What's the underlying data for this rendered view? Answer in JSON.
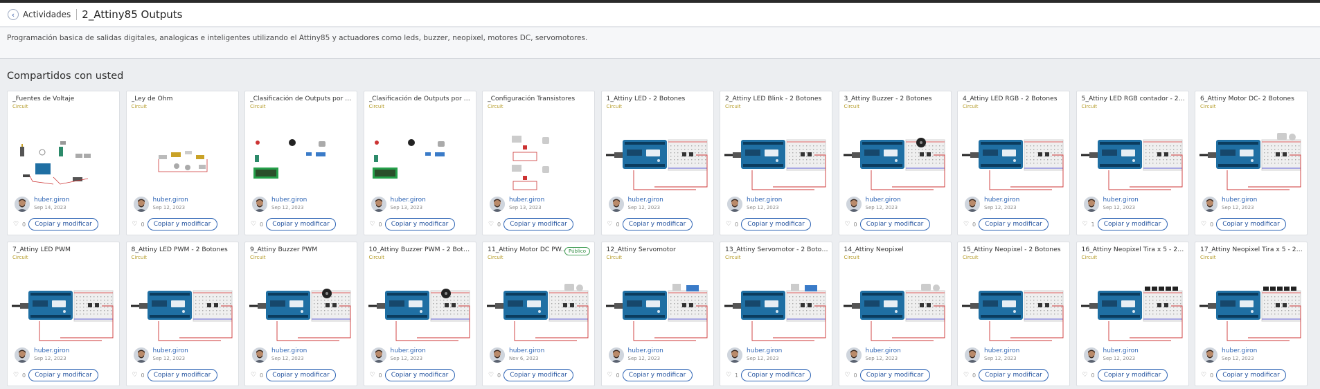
{
  "header": {
    "back_label": "Actividades",
    "title": "2_Attiny85 Outputs"
  },
  "description": "Programación basica de salidas digitales, analogicas e inteligentes utilizando el Attiny85 y actuadores como leds, buzzer, neopixel, motores DC, servomotores.",
  "section_title": "Compartidos con usted",
  "card_type": "Circuit",
  "copy_label": "Copiar y modificar",
  "cards": [
    {
      "title": "_Fuentes de Voltaje",
      "author": "huber.giron",
      "date": "Sep 14, 2023",
      "likes": "0",
      "thumb": "sources"
    },
    {
      "title": "_Ley de Ohm",
      "author": "huber.giron",
      "date": "Sep 12, 2023",
      "likes": "0",
      "thumb": "ohm"
    },
    {
      "title": "_Clasificación de Outputs por el ti...",
      "author": "huber.giron",
      "date": "Sep 12, 2023",
      "likes": "0",
      "thumb": "outputs"
    },
    {
      "title": "_Clasificación de Outputs por el ti...",
      "author": "huber.giron",
      "date": "Sep 13, 2023",
      "likes": "0",
      "thumb": "outputs2"
    },
    {
      "title": "_Configuración Transistores",
      "author": "huber.giron",
      "date": "Sep 13, 2023",
      "likes": "0",
      "thumb": "transistor"
    },
    {
      "title": "1_Attiny LED - 2 Botones",
      "author": "huber.giron",
      "date": "Sep 12, 2023",
      "likes": "0",
      "thumb": "arduino"
    },
    {
      "title": "2_Attiny LED Blink - 2 Botones",
      "author": "huber.giron",
      "date": "Sep 12, 2023",
      "likes": "0",
      "thumb": "arduino"
    },
    {
      "title": "3_Attiny Buzzer - 2 Botones",
      "author": "huber.giron",
      "date": "Sep 12, 2023",
      "likes": "0",
      "thumb": "buzzer"
    },
    {
      "title": "4_Attiny LED RGB - 2 Botones",
      "author": "huber.giron",
      "date": "Sep 12, 2023",
      "likes": "0",
      "thumb": "arduino"
    },
    {
      "title": "5_Attiny LED RGB contador - 2 Bot...",
      "author": "huber.giron",
      "date": "Sep 12, 2023",
      "likes": "1",
      "thumb": "arduino"
    },
    {
      "title": "6_Attiny Motor DC- 2 Botones",
      "author": "huber.giron",
      "date": "Sep 12, 2023",
      "likes": "0",
      "thumb": "motor"
    },
    {
      "title": "7_Attiny LED PWM",
      "author": "huber.giron",
      "date": "Sep 12, 2023",
      "likes": "0",
      "thumb": "arduino"
    },
    {
      "title": "8_Attiny LED PWM - 2 Botones",
      "author": "huber.giron",
      "date": "Sep 12, 2023",
      "likes": "0",
      "thumb": "arduino"
    },
    {
      "title": "9_Attiny Buzzer PWM",
      "author": "huber.giron",
      "date": "Sep 12, 2023",
      "likes": "0",
      "thumb": "buzzer"
    },
    {
      "title": "10_Attiny Buzzer PWM - 2 Botones",
      "author": "huber.giron",
      "date": "Sep 12, 2023",
      "likes": "0",
      "thumb": "buzzer"
    },
    {
      "title": "11_Attiny Motor DC PW...",
      "author": "huber.giron",
      "date": "Nov 6, 2023",
      "likes": "0",
      "thumb": "motor",
      "badge": "Público"
    },
    {
      "title": "12_Attiny Servomotor",
      "author": "huber.giron",
      "date": "Sep 12, 2023",
      "likes": "0",
      "thumb": "servo"
    },
    {
      "title": "13_Attiny Servomotor - 2 Botones",
      "author": "huber.giron",
      "date": "Sep 12, 2023",
      "likes": "1",
      "thumb": "servo"
    },
    {
      "title": "14_Attiny Neopixel",
      "author": "huber.giron",
      "date": "Sep 12, 2023",
      "likes": "0",
      "thumb": "motor"
    },
    {
      "title": "15_Attiny Neopixel - 2 Botones",
      "author": "huber.giron",
      "date": "Sep 12, 2023",
      "likes": "0",
      "thumb": "arduino"
    },
    {
      "title": "16_Attiny Neopixel Tira x 5 - 2 Bot...",
      "author": "huber.giron",
      "date": "Sep 12, 2023",
      "likes": "0",
      "thumb": "strip"
    },
    {
      "title": "17_Attiny Neopixel Tira x 5 - 2 Bot...",
      "author": "huber.giron",
      "date": "Sep 12, 2023",
      "likes": "0",
      "thumb": "strip"
    }
  ]
}
